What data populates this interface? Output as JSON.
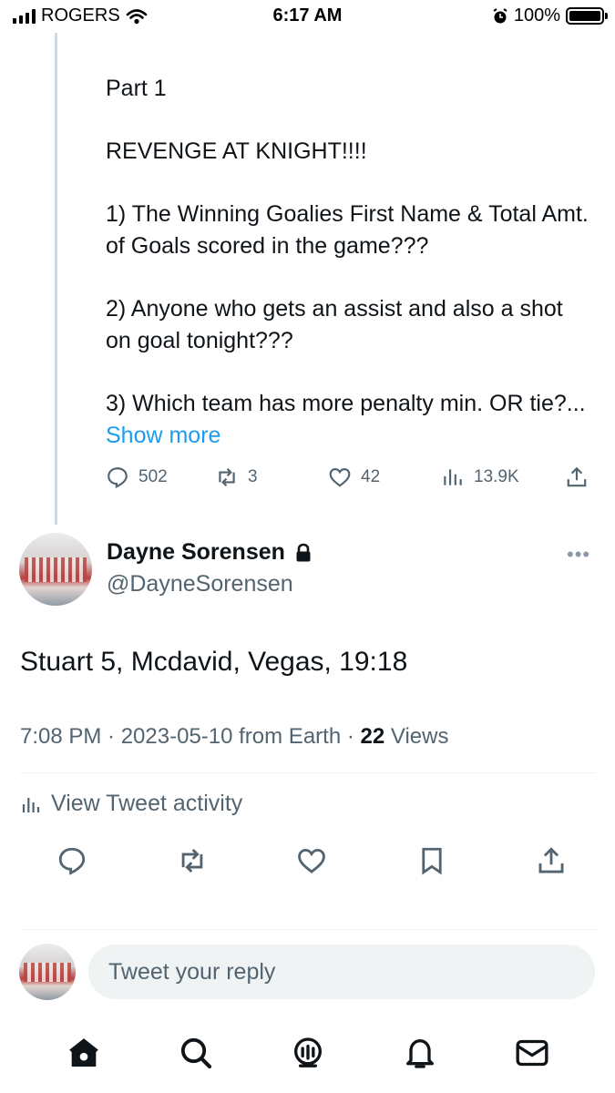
{
  "status_bar": {
    "carrier": "ROGERS",
    "time": "6:17 AM",
    "battery": "100%",
    "signal_bars": 4,
    "battery_level": 1.0
  },
  "previous_tweet": {
    "lines": [
      "Part 1",
      "REVENGE AT KNIGHT!!!!",
      "1) The Winning Goalies First Name & Total Amt. of Goals scored in the game???",
      "2) Anyone who gets an assist and also a shot on goal tonight???",
      "3) Which team has more penalty min. OR tie?..."
    ],
    "show_more": "Show more",
    "replies": "502",
    "retweets": "3",
    "likes": "42",
    "views": "13.9K"
  },
  "tweet": {
    "author_name": "Dayne Sorensen",
    "author_handle": "@DayneSorensen",
    "text": "Stuart 5, Mcdavid, Vegas, 19:18",
    "meta_prefix": "7:08 PM · 2023-05-10 from Earth · ",
    "views_count": "22",
    "views_label": " Views",
    "activity_label": "View Tweet activity"
  },
  "reply": {
    "placeholder": "Tweet your reply"
  },
  "nav": {
    "items": [
      "home-icon",
      "search-icon",
      "spaces-icon",
      "notifications-icon",
      "messages-icon"
    ]
  },
  "colors": {
    "accent": "#1d9bf0",
    "secondary_text": "#536471",
    "primary_text": "#0f1419"
  }
}
